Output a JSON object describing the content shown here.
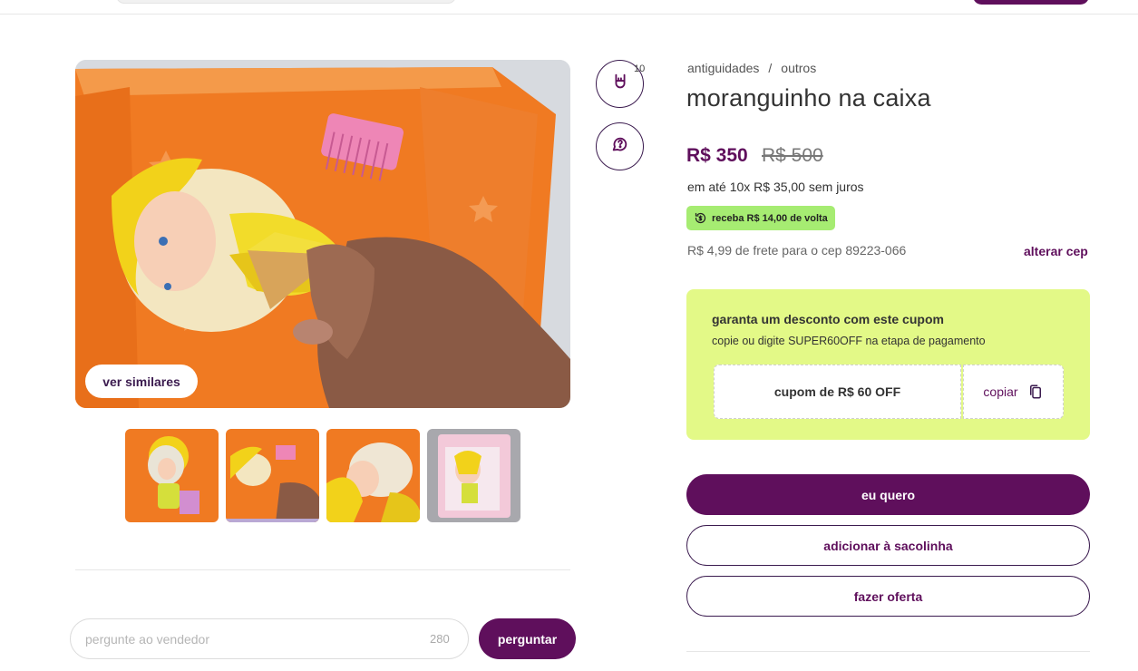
{
  "product": {
    "breadcrumb": [
      "antiguidades",
      "outros"
    ],
    "breadcrumb_sep": "/",
    "title": "moranguinho na caixa",
    "price": "R$ 350",
    "old_price": "R$ 500",
    "installments": "em até 10x R$ 35,00 sem juros",
    "cashback": "receba R$ 14,00 de volta",
    "shipping": "R$ 4,99 de frete para o cep 89223-066",
    "change_cep": "alterar cep",
    "likes": "10"
  },
  "gallery": {
    "similar_label": "ver similares",
    "thumb_count": 4,
    "active_thumb": 1
  },
  "coupon": {
    "title": "garanta um desconto com este cupom",
    "subtitle": "copie ou digite SUPER60OFF na etapa de pagamento",
    "code_label": "cupom de R$ 60 OFF",
    "copy_label": "copiar"
  },
  "actions": {
    "buy": "eu quero",
    "add_to_bag": "adicionar à sacolinha",
    "make_offer": "fazer oferta"
  },
  "ask": {
    "placeholder": "pergunte ao vendedor",
    "char_limit": "280",
    "submit": "perguntar"
  },
  "colors": {
    "brand_purple": "#5f0f5c",
    "cashback_green": "#a6ec72",
    "coupon_bg": "#e3f987"
  },
  "icons": {
    "like": "rock-hand-icon",
    "chat": "chat-question-icon",
    "cashback": "cashback-cycle-icon",
    "copy": "copy-icon"
  }
}
